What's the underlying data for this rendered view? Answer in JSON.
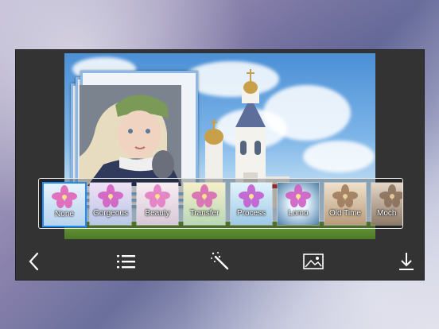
{
  "filters": [
    {
      "label": "None"
    },
    {
      "label": "Gorgeous"
    },
    {
      "label": "Beauty"
    },
    {
      "label": "Transfer"
    },
    {
      "label": "Process"
    },
    {
      "label": "Lomo"
    },
    {
      "label": "Old Time"
    },
    {
      "label": "Moch"
    }
  ],
  "selected_filter": "None",
  "toolbar": {
    "icons": [
      "back-icon",
      "list-icon",
      "magic-wand-icon",
      "image-icon",
      "download-icon"
    ]
  },
  "colors": {
    "accent": "#1c8cff",
    "frame_border": "#8bb8e6",
    "panel": "#333333"
  }
}
